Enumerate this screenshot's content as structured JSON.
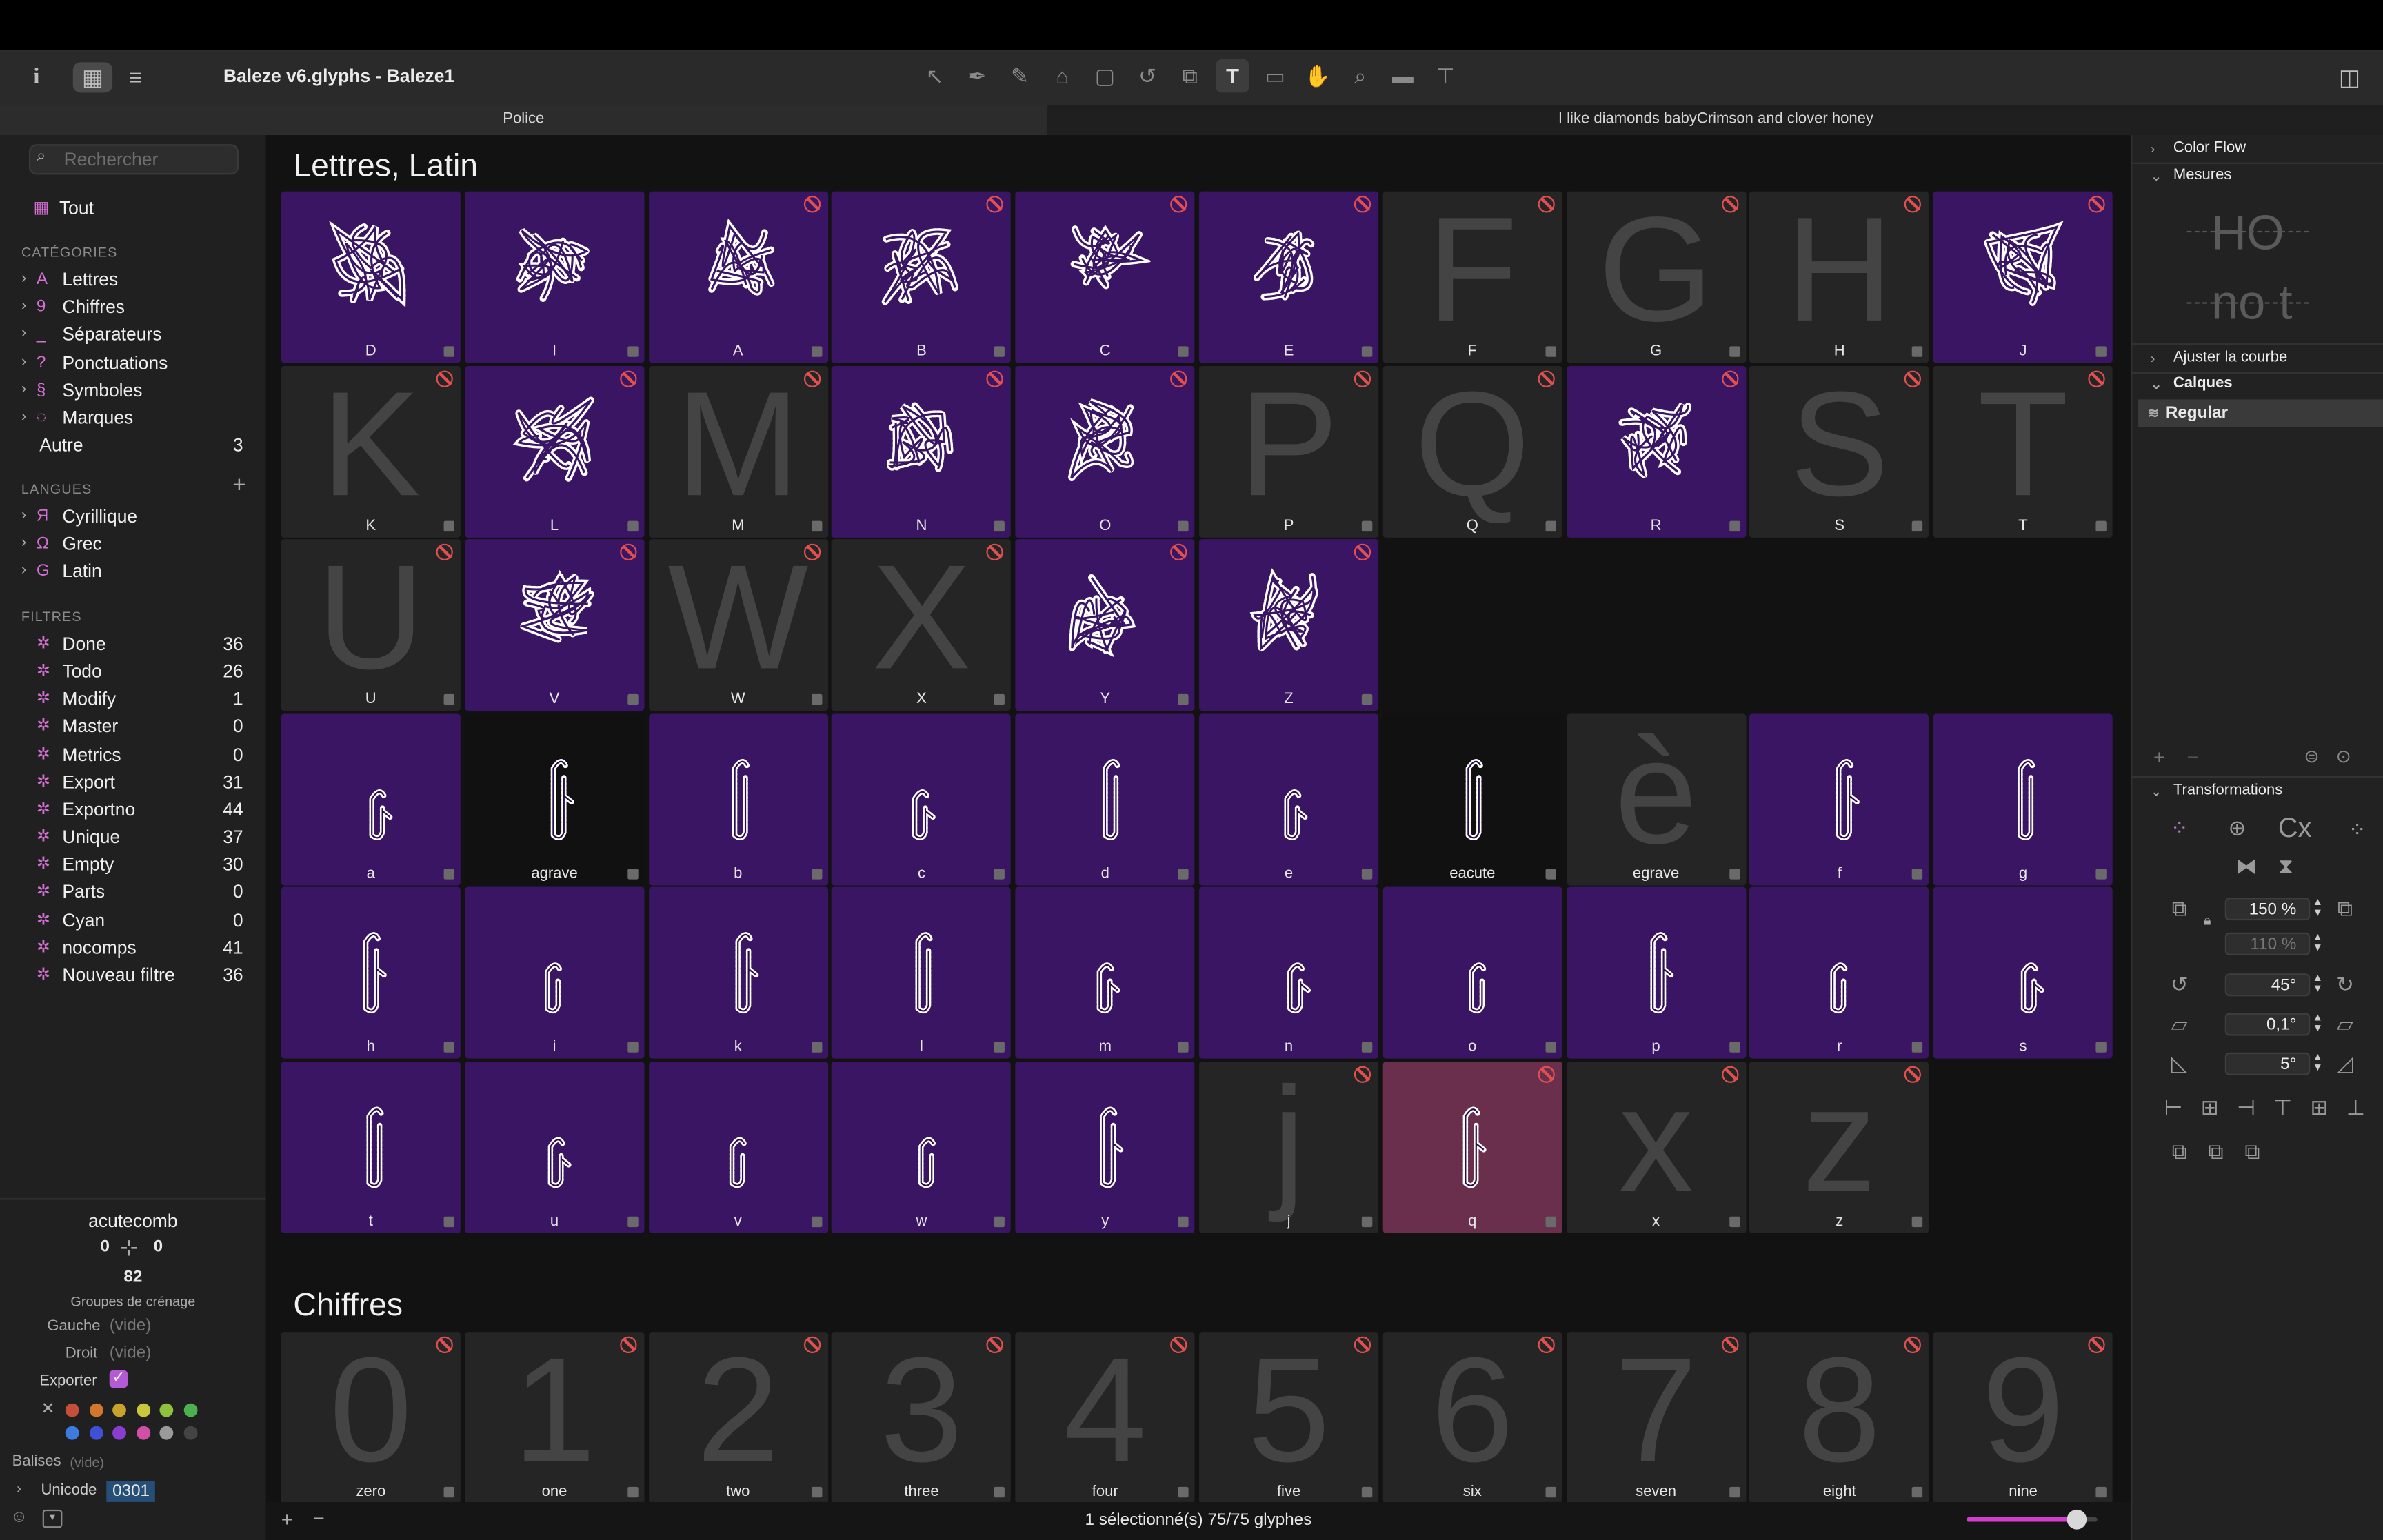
{
  "window": {
    "title": "Baleze v6.glyphs - Baleze1"
  },
  "toolbar": {
    "tools": [
      "select-tool",
      "pen-tool",
      "draw-tool",
      "anchor-tool",
      "rect-tool",
      "rotate-tool",
      "scale-tool",
      "text-tool",
      "annotation-tool",
      "hand-tool",
      "zoom-tool",
      "measure-tool",
      "ruler-tool"
    ],
    "text_glyph": "T"
  },
  "tabs": [
    {
      "label": "Police",
      "selected": true
    },
    {
      "label": "I like diamonds babyCrimson and clover honey",
      "selected": false
    }
  ],
  "sidebar": {
    "search_placeholder": "Rechercher",
    "all_label": "Tout",
    "categories_header": "CATÉGORIES",
    "categories": [
      {
        "icon": "A",
        "label": "Lettres"
      },
      {
        "icon": "9",
        "label": "Chiffres"
      },
      {
        "icon": "_",
        "label": "Séparateurs"
      },
      {
        "icon": "?",
        "label": "Ponctuations"
      },
      {
        "icon": "§",
        "label": "Symboles"
      },
      {
        "icon": "◌",
        "label": "Marques"
      }
    ],
    "other": {
      "label": "Autre",
      "count": "3"
    },
    "languages_header": "LANGUES",
    "add_symbol": "+",
    "languages": [
      {
        "icon": "Я",
        "label": "Cyrillique"
      },
      {
        "icon": "Ω",
        "label": "Grec"
      },
      {
        "icon": "G",
        "label": "Latin"
      }
    ],
    "filters_header": "FILTRES",
    "filters": [
      {
        "label": "Done",
        "count": "36"
      },
      {
        "label": "Todo",
        "count": "26"
      },
      {
        "label": "Modify",
        "count": "1"
      },
      {
        "label": "Master",
        "count": "0"
      },
      {
        "label": "Metrics",
        "count": "0"
      },
      {
        "label": "Export",
        "count": "31"
      },
      {
        "label": "Exportno",
        "count": "44"
      },
      {
        "label": "Unique",
        "count": "37"
      },
      {
        "label": "Empty",
        "count": "30"
      },
      {
        "label": "Parts",
        "count": "0"
      },
      {
        "label": "Cyan",
        "count": "0"
      },
      {
        "label": "nocomps",
        "count": "41"
      },
      {
        "label": "Nouveau filtre",
        "count": "36"
      }
    ]
  },
  "glyph_info": {
    "name": "acutecomb",
    "lsb": "0",
    "rsb": "0",
    "width": "82",
    "kerning_label": "Groupes de crénage",
    "left_label": "Gauche",
    "left_value": "(vide)",
    "right_label": "Droit",
    "right_value": "(vide)",
    "export_label": "Exporter",
    "tags_label": "Balises",
    "tags_value": "(vide)",
    "unicode_label": "Unicode",
    "unicode_value": "0301",
    "color_x": "✕",
    "colors_row1": [
      "#c4503c",
      "#d2782e",
      "#c9a22c",
      "#c9c83a",
      "#8cc23c",
      "#4caf50"
    ],
    "colors_row2": [
      "#3d7be0",
      "#3f4fd6",
      "#8a3ed0",
      "#d24fa8",
      "#9a9a9a",
      "#444444"
    ]
  },
  "sections": [
    {
      "title": "Lettres, Latin"
    },
    {
      "title": "Chiffres"
    }
  ],
  "glyphs": [
    {
      "name": "D",
      "style": "p",
      "kind": "orn",
      "ban": false
    },
    {
      "name": "I",
      "style": "p",
      "kind": "orn",
      "ban": false
    },
    {
      "name": "A",
      "style": "p",
      "kind": "orn",
      "ban": true
    },
    {
      "name": "B",
      "style": "p",
      "kind": "orn",
      "ban": true
    },
    {
      "name": "C",
      "style": "p",
      "kind": "orn",
      "ban": true
    },
    {
      "name": "E",
      "style": "p",
      "kind": "orn",
      "ban": true
    },
    {
      "name": "F",
      "style": "g",
      "kind": "big",
      "char": "F",
      "ban": true
    },
    {
      "name": "G",
      "style": "g",
      "kind": "big",
      "char": "G",
      "ban": true
    },
    {
      "name": "H",
      "style": "g",
      "kind": "big",
      "char": "H",
      "ban": true
    },
    {
      "name": "J",
      "style": "p",
      "kind": "orn",
      "ban": true
    },
    {
      "name": "K",
      "style": "g",
      "kind": "big",
      "char": "K",
      "ban": true
    },
    {
      "name": "L",
      "style": "p",
      "kind": "orn",
      "ban": true
    },
    {
      "name": "M",
      "style": "g",
      "kind": "big",
      "char": "M",
      "ban": true
    },
    {
      "name": "N",
      "style": "p",
      "kind": "orn",
      "ban": true
    },
    {
      "name": "O",
      "style": "p",
      "kind": "orn",
      "ban": true
    },
    {
      "name": "P",
      "style": "g",
      "kind": "big",
      "char": "P",
      "ban": true
    },
    {
      "name": "Q",
      "style": "g",
      "kind": "big",
      "char": "Q",
      "ban": true
    },
    {
      "name": "R",
      "style": "p",
      "kind": "orn",
      "ban": true
    },
    {
      "name": "S",
      "style": "g",
      "kind": "big",
      "char": "S",
      "ban": true
    },
    {
      "name": "T",
      "style": "g",
      "kind": "big",
      "char": "T",
      "ban": true
    },
    {
      "name": "U",
      "style": "g",
      "kind": "big",
      "char": "U",
      "ban": true
    },
    {
      "name": "V",
      "style": "p",
      "kind": "orn",
      "ban": true
    },
    {
      "name": "W",
      "style": "g",
      "kind": "big",
      "char": "W",
      "ban": true
    },
    {
      "name": "X",
      "style": "g",
      "kind": "big",
      "char": "X",
      "ban": true
    },
    {
      "name": "Y",
      "style": "p",
      "kind": "orn",
      "ban": true
    },
    {
      "name": "Z",
      "style": "p",
      "kind": "orn",
      "ban": true
    },
    {
      "name": "",
      "style": "none",
      "kind": "none",
      "ban": false
    },
    {
      "name": "",
      "style": "none",
      "kind": "none",
      "ban": false
    },
    {
      "name": "",
      "style": "none",
      "kind": "none",
      "ban": false
    },
    {
      "name": "",
      "style": "none",
      "kind": "none",
      "ban": false
    },
    {
      "name": "a",
      "style": "p",
      "kind": "stroke",
      "ban": false
    },
    {
      "name": "agrave",
      "style": "e",
      "kind": "stroke",
      "ban": false
    },
    {
      "name": "b",
      "style": "p",
      "kind": "stroke",
      "ban": false
    },
    {
      "name": "c",
      "style": "p",
      "kind": "stroke",
      "ban": false
    },
    {
      "name": "d",
      "style": "p",
      "kind": "stroke",
      "ban": false
    },
    {
      "name": "e",
      "style": "p",
      "kind": "stroke",
      "ban": false
    },
    {
      "name": "eacute",
      "style": "e",
      "kind": "stroke",
      "ban": false
    },
    {
      "name": "egrave",
      "style": "g",
      "kind": "big",
      "char": "è",
      "ban": false
    },
    {
      "name": "f",
      "style": "p",
      "kind": "stroke",
      "ban": false
    },
    {
      "name": "g",
      "style": "p",
      "kind": "stroke",
      "ban": false
    },
    {
      "name": "h",
      "style": "p",
      "kind": "stroke",
      "ban": false
    },
    {
      "name": "i",
      "style": "p",
      "kind": "stroke",
      "ban": false
    },
    {
      "name": "k",
      "style": "p",
      "kind": "stroke",
      "ban": false
    },
    {
      "name": "l",
      "style": "p",
      "kind": "stroke",
      "ban": false
    },
    {
      "name": "m",
      "style": "p",
      "kind": "stroke",
      "ban": false
    },
    {
      "name": "n",
      "style": "p",
      "kind": "stroke",
      "ban": false
    },
    {
      "name": "o",
      "style": "p",
      "kind": "stroke",
      "ban": false
    },
    {
      "name": "p",
      "style": "p",
      "kind": "stroke",
      "ban": false
    },
    {
      "name": "r",
      "style": "p",
      "kind": "stroke",
      "ban": false
    },
    {
      "name": "s",
      "style": "p",
      "kind": "stroke",
      "ban": false
    },
    {
      "name": "t",
      "style": "p",
      "kind": "stroke",
      "ban": false
    },
    {
      "name": "u",
      "style": "p",
      "kind": "stroke",
      "ban": false
    },
    {
      "name": "v",
      "style": "p",
      "kind": "stroke",
      "ban": false
    },
    {
      "name": "w",
      "style": "p",
      "kind": "stroke",
      "ban": false
    },
    {
      "name": "y",
      "style": "p",
      "kind": "stroke",
      "ban": false
    },
    {
      "name": "j",
      "style": "g",
      "kind": "big",
      "char": "j",
      "ban": true
    },
    {
      "name": "q",
      "style": "q",
      "kind": "stroke",
      "ban": true
    },
    {
      "name": "x",
      "style": "g",
      "kind": "big",
      "char": "x",
      "ban": true
    },
    {
      "name": "z",
      "style": "g",
      "kind": "big",
      "char": "z",
      "ban": true
    }
  ],
  "digits": [
    {
      "name": "zero",
      "char": "0"
    },
    {
      "name": "one",
      "char": "1"
    },
    {
      "name": "two",
      "char": "2"
    },
    {
      "name": "three",
      "char": "3"
    },
    {
      "name": "four",
      "char": "4"
    },
    {
      "name": "five",
      "char": "5"
    },
    {
      "name": "six",
      "char": "6"
    },
    {
      "name": "seven",
      "char": "7"
    },
    {
      "name": "eight",
      "char": "8"
    },
    {
      "name": "nine",
      "char": "9"
    }
  ],
  "status": {
    "text": "1 sélectionné(s) 75/75 glyphes",
    "zoom_level": 0.84
  },
  "right_panel": {
    "color_flow": "Color Flow",
    "mesures": "Mesures",
    "preview_top": "HO",
    "preview_bottom": "no t",
    "ajuster": "Ajuster la courbe",
    "calques": "Calques",
    "layer": "Regular",
    "transformations": "Transformations",
    "cx_label": "Cx",
    "scale_x": "150 %",
    "scale_y": "110 %",
    "rotate": "45°",
    "slant": "0,1°",
    "skew": "5°"
  },
  "colors": {
    "purple_cell": "#3a1564",
    "pink_cell": "#6b2f4e",
    "accent": "#d46fd4",
    "ban": "#e05050"
  }
}
